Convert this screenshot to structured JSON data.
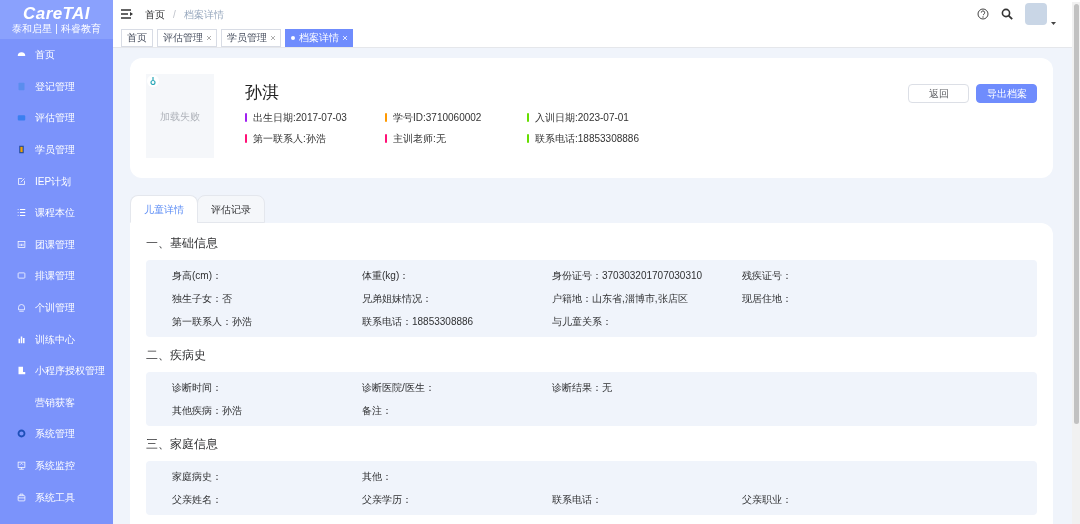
{
  "sidebar": {
    "logo": "CareTAI",
    "logo_subtitle": "泰和启星 | 科睿教育",
    "items": [
      {
        "label": "首页"
      },
      {
        "label": "登记管理"
      },
      {
        "label": "评估管理"
      },
      {
        "label": "学员管理"
      },
      {
        "label": "IEP计划"
      },
      {
        "label": "课程本位"
      },
      {
        "label": "团课管理"
      },
      {
        "label": "排课管理"
      },
      {
        "label": "个训管理"
      },
      {
        "label": "训练中心"
      },
      {
        "label": "小程序授权管理"
      },
      {
        "label": "营销获客"
      },
      {
        "label": "系统管理"
      },
      {
        "label": "系统监控"
      },
      {
        "label": "系统工具"
      }
    ]
  },
  "breadcrumb": {
    "separator": "/",
    "items": [
      "首页",
      "档案详情"
    ]
  },
  "tags": [
    {
      "label": "首页",
      "selected": false,
      "closable": false
    },
    {
      "label": "评估管理",
      "selected": false,
      "closable": true
    },
    {
      "label": "学员管理",
      "selected": false,
      "closable": true
    },
    {
      "label": "档案详情",
      "selected": true,
      "closable": true
    }
  ],
  "profile": {
    "photo_text": "加载失败",
    "name": "孙淇",
    "facts": [
      {
        "text": "出生日期:2017-07-03",
        "color": "#a020f0"
      },
      {
        "text": "学号ID:3710060002",
        "color": "#ff9900"
      },
      {
        "text": "入训日期:2023-07-01",
        "color": "#66dd00"
      },
      {
        "text": "第一联系人:孙浩",
        "color": "#ff1177"
      },
      {
        "text": "主训老师:无",
        "color": "#ff1177"
      },
      {
        "text": "联系电话:18853308886",
        "color": "#66dd00"
      }
    ],
    "buttons": [
      {
        "label": "返回",
        "kind": "plain"
      },
      {
        "label": "导出档案",
        "kind": "primary"
      }
    ]
  },
  "tabs": [
    {
      "label": "儿童详情",
      "selected": true
    },
    {
      "label": "评估记录",
      "selected": false
    }
  ],
  "sections": [
    {
      "title": "一、基础信息",
      "fields": [
        {
          "label": "身高(cm)："
        },
        {
          "label": "体重(kg)："
        },
        {
          "label": "身份证号：",
          "value": "370303201707030310"
        },
        {
          "label": "残疾证号："
        },
        {
          "label": "独生子女：",
          "value": "否"
        },
        {
          "label": "兄弟姐妹情况："
        },
        {
          "label": "户籍地：",
          "value": "山东省,淄博市,张店区"
        },
        {
          "label": "现居住地："
        },
        {
          "label": "第一联系人：",
          "value": "孙浩"
        },
        {
          "label": "联系电话：",
          "value": "18853308886"
        },
        {
          "label": "与儿童关系："
        }
      ]
    },
    {
      "title": "二、疾病史",
      "fields": [
        {
          "label": "诊断时间："
        },
        {
          "label": "诊断医院/医生："
        },
        {
          "label": "诊断结果：",
          "value": "无"
        },
        {
          "label": "其他疾病：",
          "value": "孙浩",
          "newline": true
        },
        {
          "label": "备注："
        }
      ]
    },
    {
      "title": "三、家庭信息",
      "fields": [
        {
          "label": "家庭病史："
        },
        {
          "label": "其他：",
          "rowend": true
        },
        {
          "label": "父亲姓名："
        },
        {
          "label": "父亲学历："
        },
        {
          "label": "联系电话："
        },
        {
          "label": "父亲职业："
        }
      ]
    }
  ]
}
